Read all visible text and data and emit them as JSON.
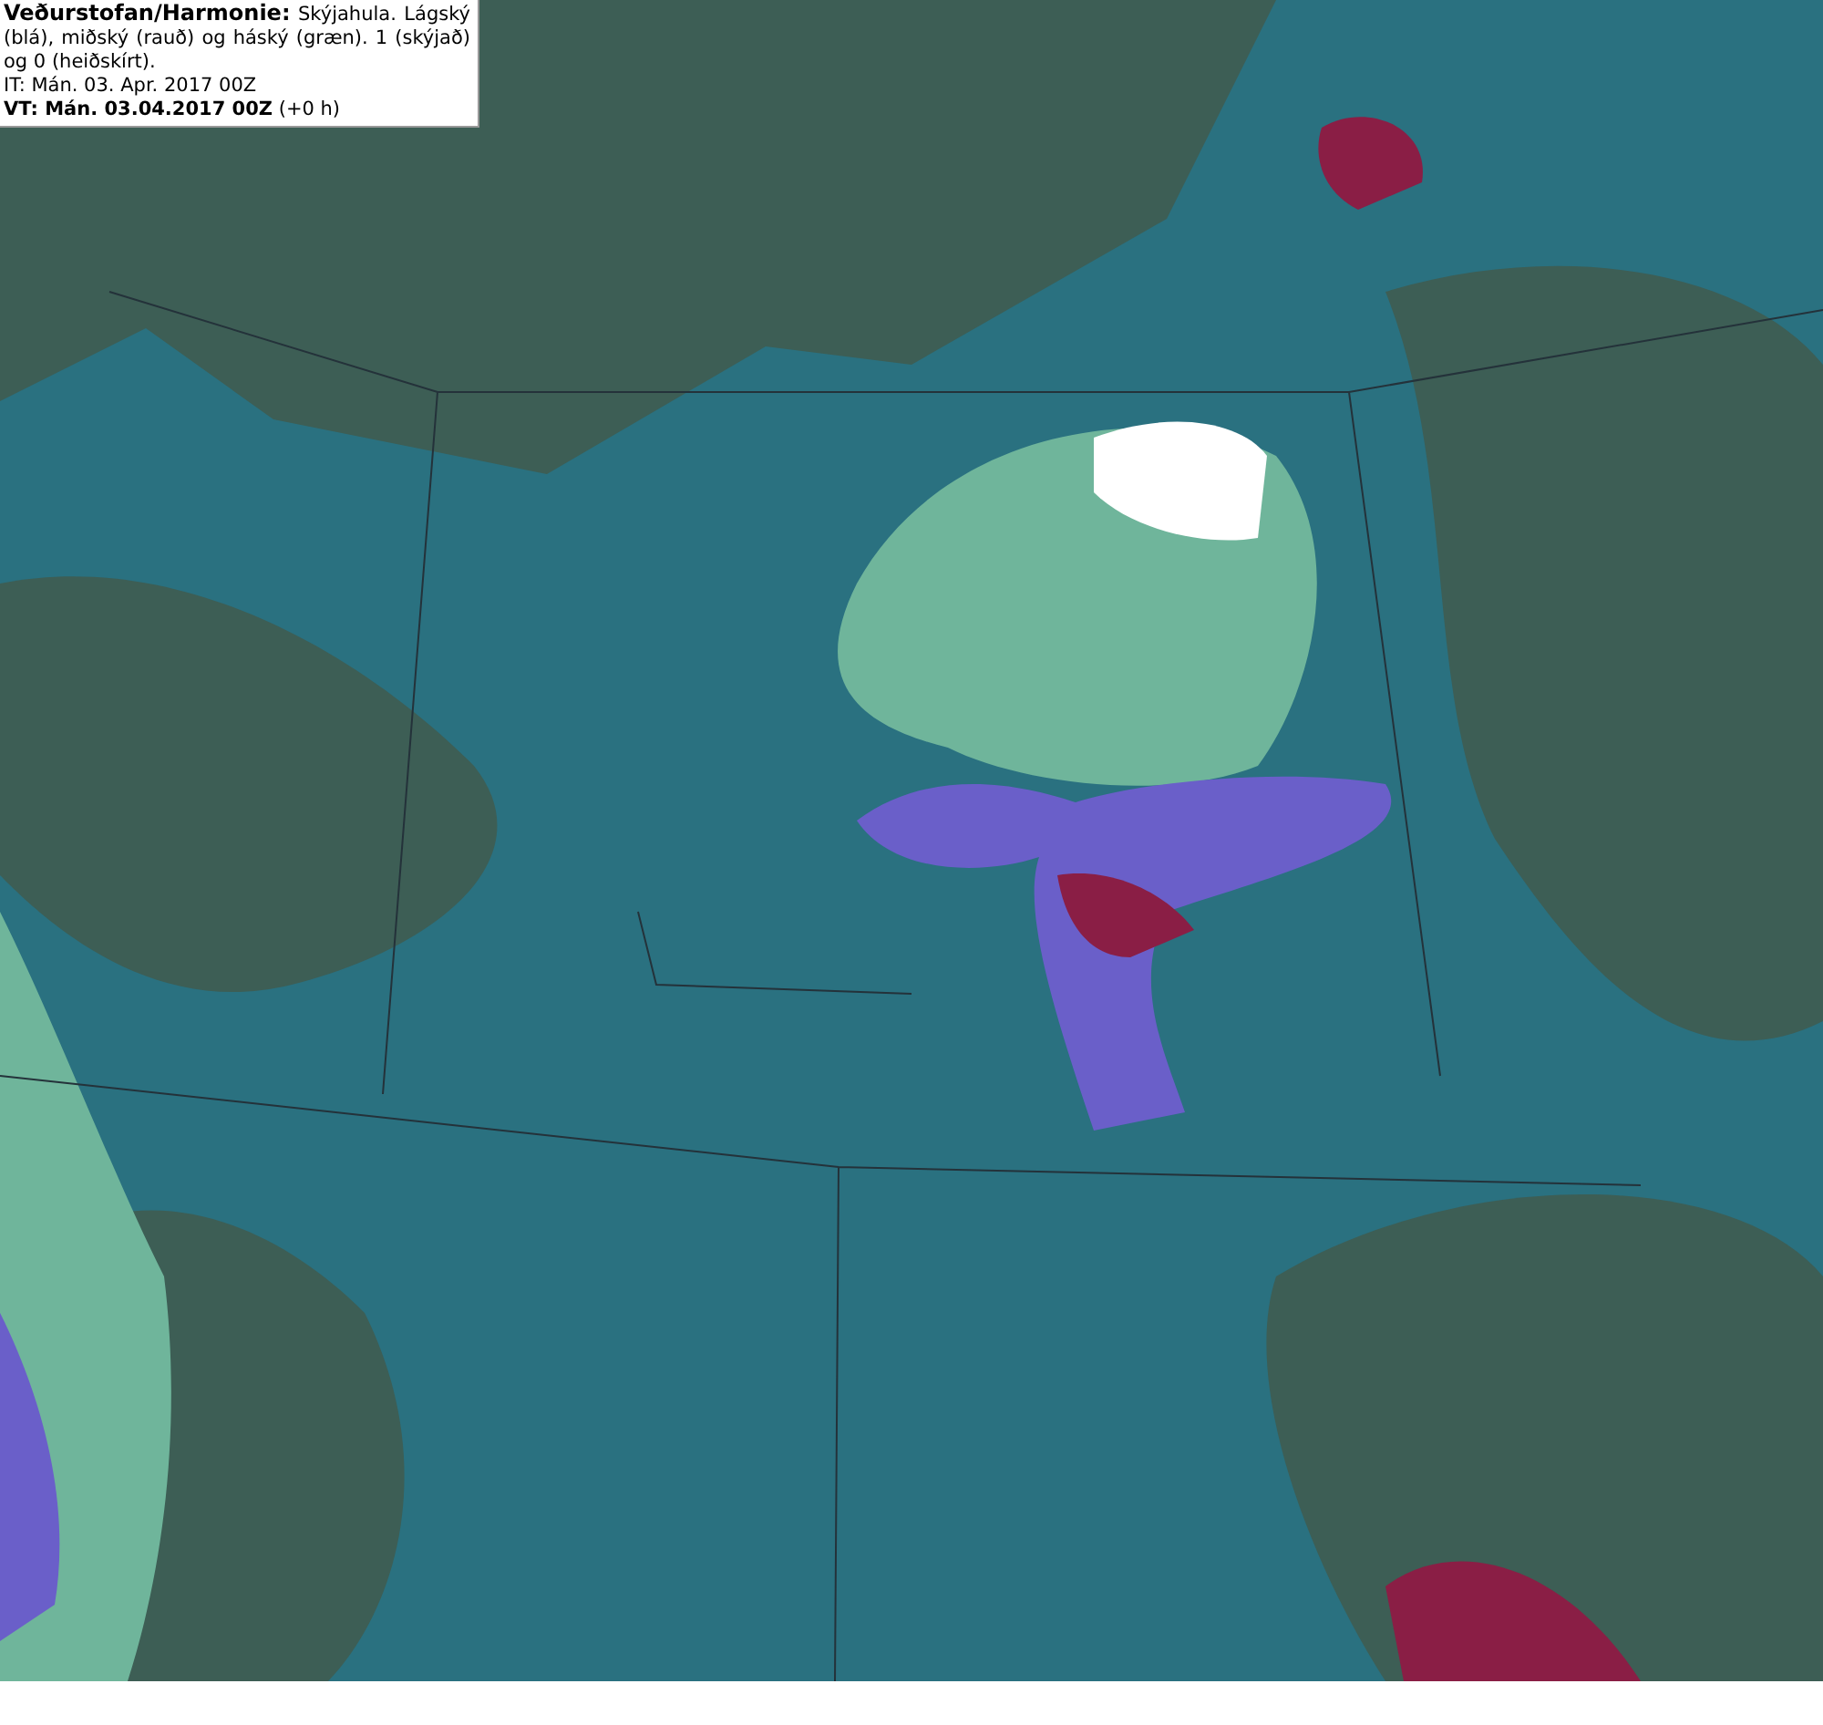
{
  "legend": {
    "description": "**Veðurstofan/Harmonie:** Skýjahula. Lágský (blá), miðský (rauð) og háský (græn). 1 (skýjað) og 0 (heiðskírt).",
    "issue_time": "IT: Mán. 03. Apr. 2017 00Z",
    "valid_time": "**VT: Mán. 03.04.2017 00Z** (+0 h)"
  }
}
